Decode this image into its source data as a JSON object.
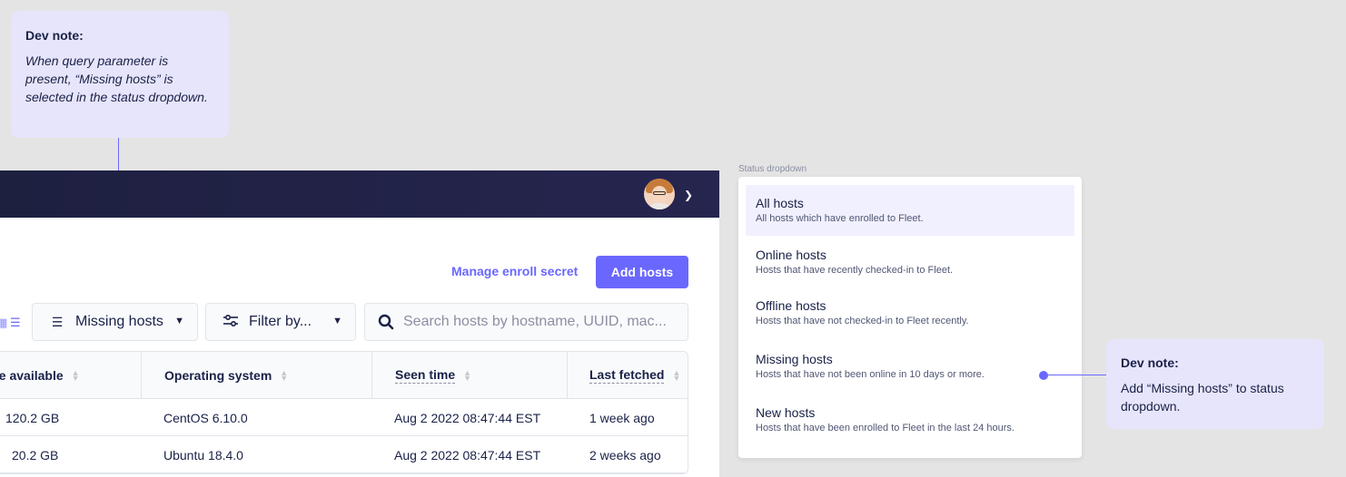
{
  "dev_note_1": {
    "title": "Dev note:",
    "body": "When query parameter is present, “Missing hosts” is selected in the status dropdown."
  },
  "dev_note_2": {
    "title": "Dev note:",
    "body": "Add “Missing hosts” to status dropdown."
  },
  "toolbar": {
    "manage_secret_label": "Manage enroll secret",
    "add_hosts_label": "Add hosts"
  },
  "filters": {
    "status_selected": "Missing hosts",
    "filter_by_label": "Filter by...",
    "search_placeholder": "Search hosts by hostname, UUID, mac..."
  },
  "table": {
    "columns": [
      "ce available",
      "Operating system",
      "Seen time",
      "Last fetched"
    ],
    "rows": [
      [
        "120.2 GB",
        "CentOS 6.10.0",
        "Aug 2 2022 08:47:44 EST",
        "1 week ago"
      ],
      [
        "20.2 GB",
        "Ubuntu 18.4.0",
        "Aug 2 2022 08:47:44 EST",
        "2 weeks ago"
      ]
    ]
  },
  "status_dropdown": {
    "label": "Status dropdown",
    "options": [
      {
        "title": "All hosts",
        "desc": "All hosts which have enrolled to Fleet."
      },
      {
        "title": "Online hosts",
        "desc": "Hosts that have recently checked-in to Fleet."
      },
      {
        "title": "Offline hosts",
        "desc": "Hosts that have not checked-in to Fleet recently."
      },
      {
        "title": "Missing hosts",
        "desc": "Hosts that have not been online in 10 days or more."
      },
      {
        "title": "New hosts",
        "desc": "Hosts that have been enrolled to Fleet in the last 24 hours."
      }
    ]
  },
  "colors": {
    "accent": "#6a67fe",
    "nav_background": "#201e43",
    "note_background": "#e7e5fb"
  }
}
